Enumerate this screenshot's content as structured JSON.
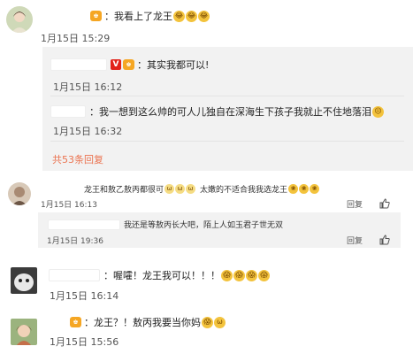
{
  "thread": {
    "c1": {
      "text": "我看上了龙王",
      "emojis": [
        "laugh-cry-emoji",
        "laugh-cry-emoji",
        "laugh-cry-emoji"
      ],
      "time": "1月15日 15:29",
      "replies": {
        "r1": {
          "text": "其实我都可以!",
          "time": "1月15日 16:12"
        },
        "r2": {
          "text": "我一想到这么帅的可人儿独自在深海生下孩子我就止不住地落泪",
          "time": "1月15日 16:32"
        },
        "more_link": "共53条回复"
      }
    },
    "c2": {
      "text_a": "龙王和敖乙敖丙都很可",
      "text_b": "太嫩的不适合我我选龙王",
      "time": "1月15日 16:13",
      "reply_label": "回复",
      "reply": {
        "text": "我还是等敖丙长大吧，陌上人如玉君子世无双",
        "time": "1月15日 19:36",
        "reply_label": "回复"
      }
    },
    "c3": {
      "text": "喔嚯！龙王我可以！！！",
      "time": "1月15日 16:14"
    },
    "c4": {
      "text": "龙王？！敖丙我要当你妈",
      "time": "1月15日 15:56"
    }
  },
  "colors": {
    "accent_link": "#eb7350",
    "badge_red": "#e2231a",
    "badge_orange": "#f5a623",
    "panel_bg": "#f2f2f2",
    "emoji_yellow": "#f3c33d"
  }
}
